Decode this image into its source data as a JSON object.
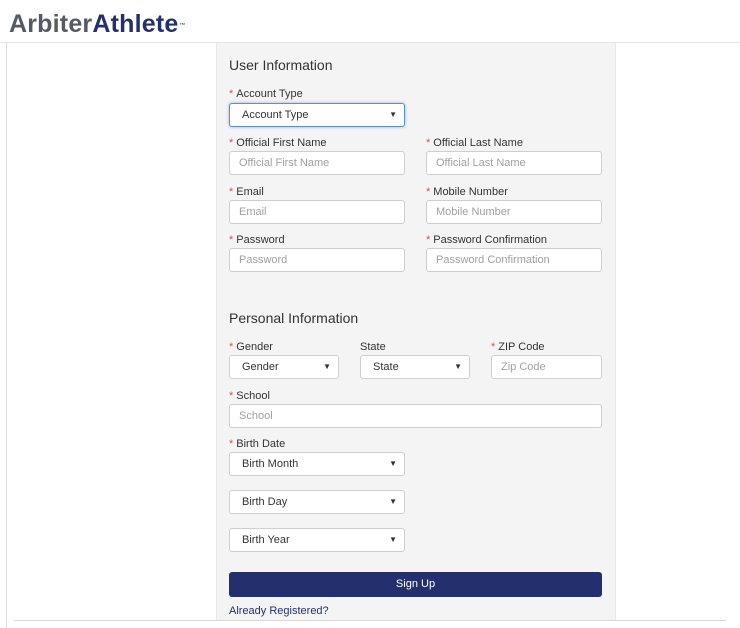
{
  "brand": {
    "part1": "Arbiter",
    "part2": "Athlete",
    "tm": "™"
  },
  "user_section": {
    "title": "User Information",
    "account_type": {
      "label": "Account Type",
      "value": "Account Type"
    },
    "first_name": {
      "label": "Official First Name",
      "placeholder": "Official First Name"
    },
    "last_name": {
      "label": "Official Last Name",
      "placeholder": "Official Last Name"
    },
    "email": {
      "label": "Email",
      "placeholder": "Email"
    },
    "mobile": {
      "label": "Mobile Number",
      "placeholder": "Mobile Number"
    },
    "password": {
      "label": "Password",
      "placeholder": "Password"
    },
    "password_confirm": {
      "label": "Password Confirmation",
      "placeholder": "Password Confirmation"
    }
  },
  "personal_section": {
    "title": "Personal Information",
    "gender": {
      "label": "Gender",
      "value": "Gender"
    },
    "state": {
      "label": "State",
      "value": "State"
    },
    "zip": {
      "label": "ZIP Code",
      "placeholder": "Zip Code"
    },
    "school": {
      "label": "School",
      "placeholder": "School"
    },
    "birth_date": {
      "label": "Birth Date",
      "month": "Birth Month",
      "day": "Birth Day",
      "year": "Birth Year"
    }
  },
  "required_marker": "*",
  "dropdown_caret": "▼",
  "actions": {
    "sign_up": "Sign Up",
    "already_registered": "Already Registered?"
  },
  "colors": {
    "brand_navy": "#24306e",
    "required_red": "#d9534f",
    "focus_blue": "#5a8fd6"
  }
}
